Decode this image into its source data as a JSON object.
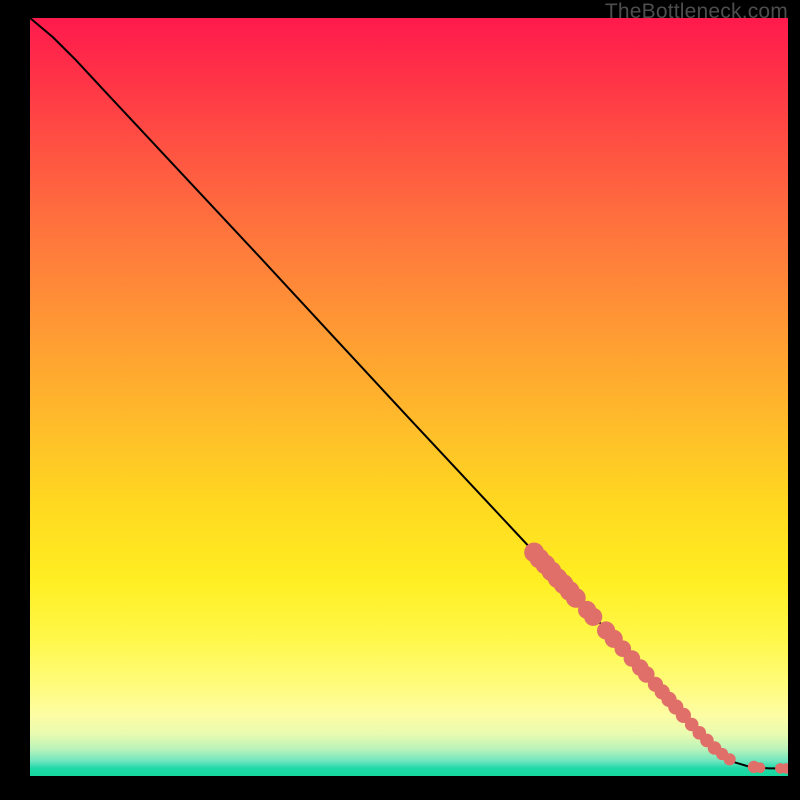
{
  "watermark": "TheBottleneck.com",
  "chart_data": {
    "type": "line",
    "title": "",
    "xlabel": "",
    "ylabel": "",
    "xlim": [
      0,
      100
    ],
    "ylim": [
      0,
      100
    ],
    "curve": [
      {
        "x": 0,
        "y": 100
      },
      {
        "x": 3,
        "y": 97.5
      },
      {
        "x": 6,
        "y": 94.5
      },
      {
        "x": 10,
        "y": 90.2
      },
      {
        "x": 20,
        "y": 79.5
      },
      {
        "x": 30,
        "y": 68.8
      },
      {
        "x": 40,
        "y": 58.0
      },
      {
        "x": 50,
        "y": 47.2
      },
      {
        "x": 60,
        "y": 36.5
      },
      {
        "x": 70,
        "y": 25.8
      },
      {
        "x": 80,
        "y": 15.0
      },
      {
        "x": 85,
        "y": 9.5
      },
      {
        "x": 88,
        "y": 6.0
      },
      {
        "x": 91,
        "y": 3.2
      },
      {
        "x": 93,
        "y": 1.8
      },
      {
        "x": 95,
        "y": 1.2
      },
      {
        "x": 97.5,
        "y": 1.0
      },
      {
        "x": 100,
        "y": 1.0
      }
    ],
    "markers": [
      {
        "x": 66.5,
        "y": 29.5,
        "r": 1.3
      },
      {
        "x": 67.2,
        "y": 28.7,
        "r": 1.3
      },
      {
        "x": 68.0,
        "y": 27.9,
        "r": 1.3
      },
      {
        "x": 68.8,
        "y": 27.0,
        "r": 1.3
      },
      {
        "x": 69.6,
        "y": 26.1,
        "r": 1.3
      },
      {
        "x": 70.4,
        "y": 25.3,
        "r": 1.3
      },
      {
        "x": 71.2,
        "y": 24.4,
        "r": 1.3
      },
      {
        "x": 72.0,
        "y": 23.5,
        "r": 1.3
      },
      {
        "x": 73.5,
        "y": 21.9,
        "r": 1.2
      },
      {
        "x": 74.3,
        "y": 21.0,
        "r": 1.2
      },
      {
        "x": 76.0,
        "y": 19.2,
        "r": 1.2
      },
      {
        "x": 77.0,
        "y": 18.1,
        "r": 1.2
      },
      {
        "x": 78.2,
        "y": 16.8,
        "r": 1.1
      },
      {
        "x": 79.4,
        "y": 15.5,
        "r": 1.1
      },
      {
        "x": 80.5,
        "y": 14.3,
        "r": 1.1
      },
      {
        "x": 81.3,
        "y": 13.4,
        "r": 1.1
      },
      {
        "x": 82.5,
        "y": 12.1,
        "r": 1.0
      },
      {
        "x": 83.4,
        "y": 11.1,
        "r": 1.0
      },
      {
        "x": 84.3,
        "y": 10.1,
        "r": 1.0
      },
      {
        "x": 85.2,
        "y": 9.1,
        "r": 1.0
      },
      {
        "x": 86.2,
        "y": 8.0,
        "r": 1.0
      },
      {
        "x": 87.3,
        "y": 6.8,
        "r": 0.9
      },
      {
        "x": 88.3,
        "y": 5.7,
        "r": 0.9
      },
      {
        "x": 89.3,
        "y": 4.7,
        "r": 0.9
      },
      {
        "x": 90.3,
        "y": 3.7,
        "r": 0.9
      },
      {
        "x": 91.3,
        "y": 2.9,
        "r": 0.8
      },
      {
        "x": 92.3,
        "y": 2.2,
        "r": 0.8
      },
      {
        "x": 95.5,
        "y": 1.2,
        "r": 0.8
      },
      {
        "x": 96.3,
        "y": 1.1,
        "r": 0.7
      },
      {
        "x": 99.0,
        "y": 1.0,
        "r": 0.7
      },
      {
        "x": 99.8,
        "y": 1.0,
        "r": 0.7
      }
    ],
    "marker_color": "#e06f6a",
    "curve_color": "#000000"
  }
}
